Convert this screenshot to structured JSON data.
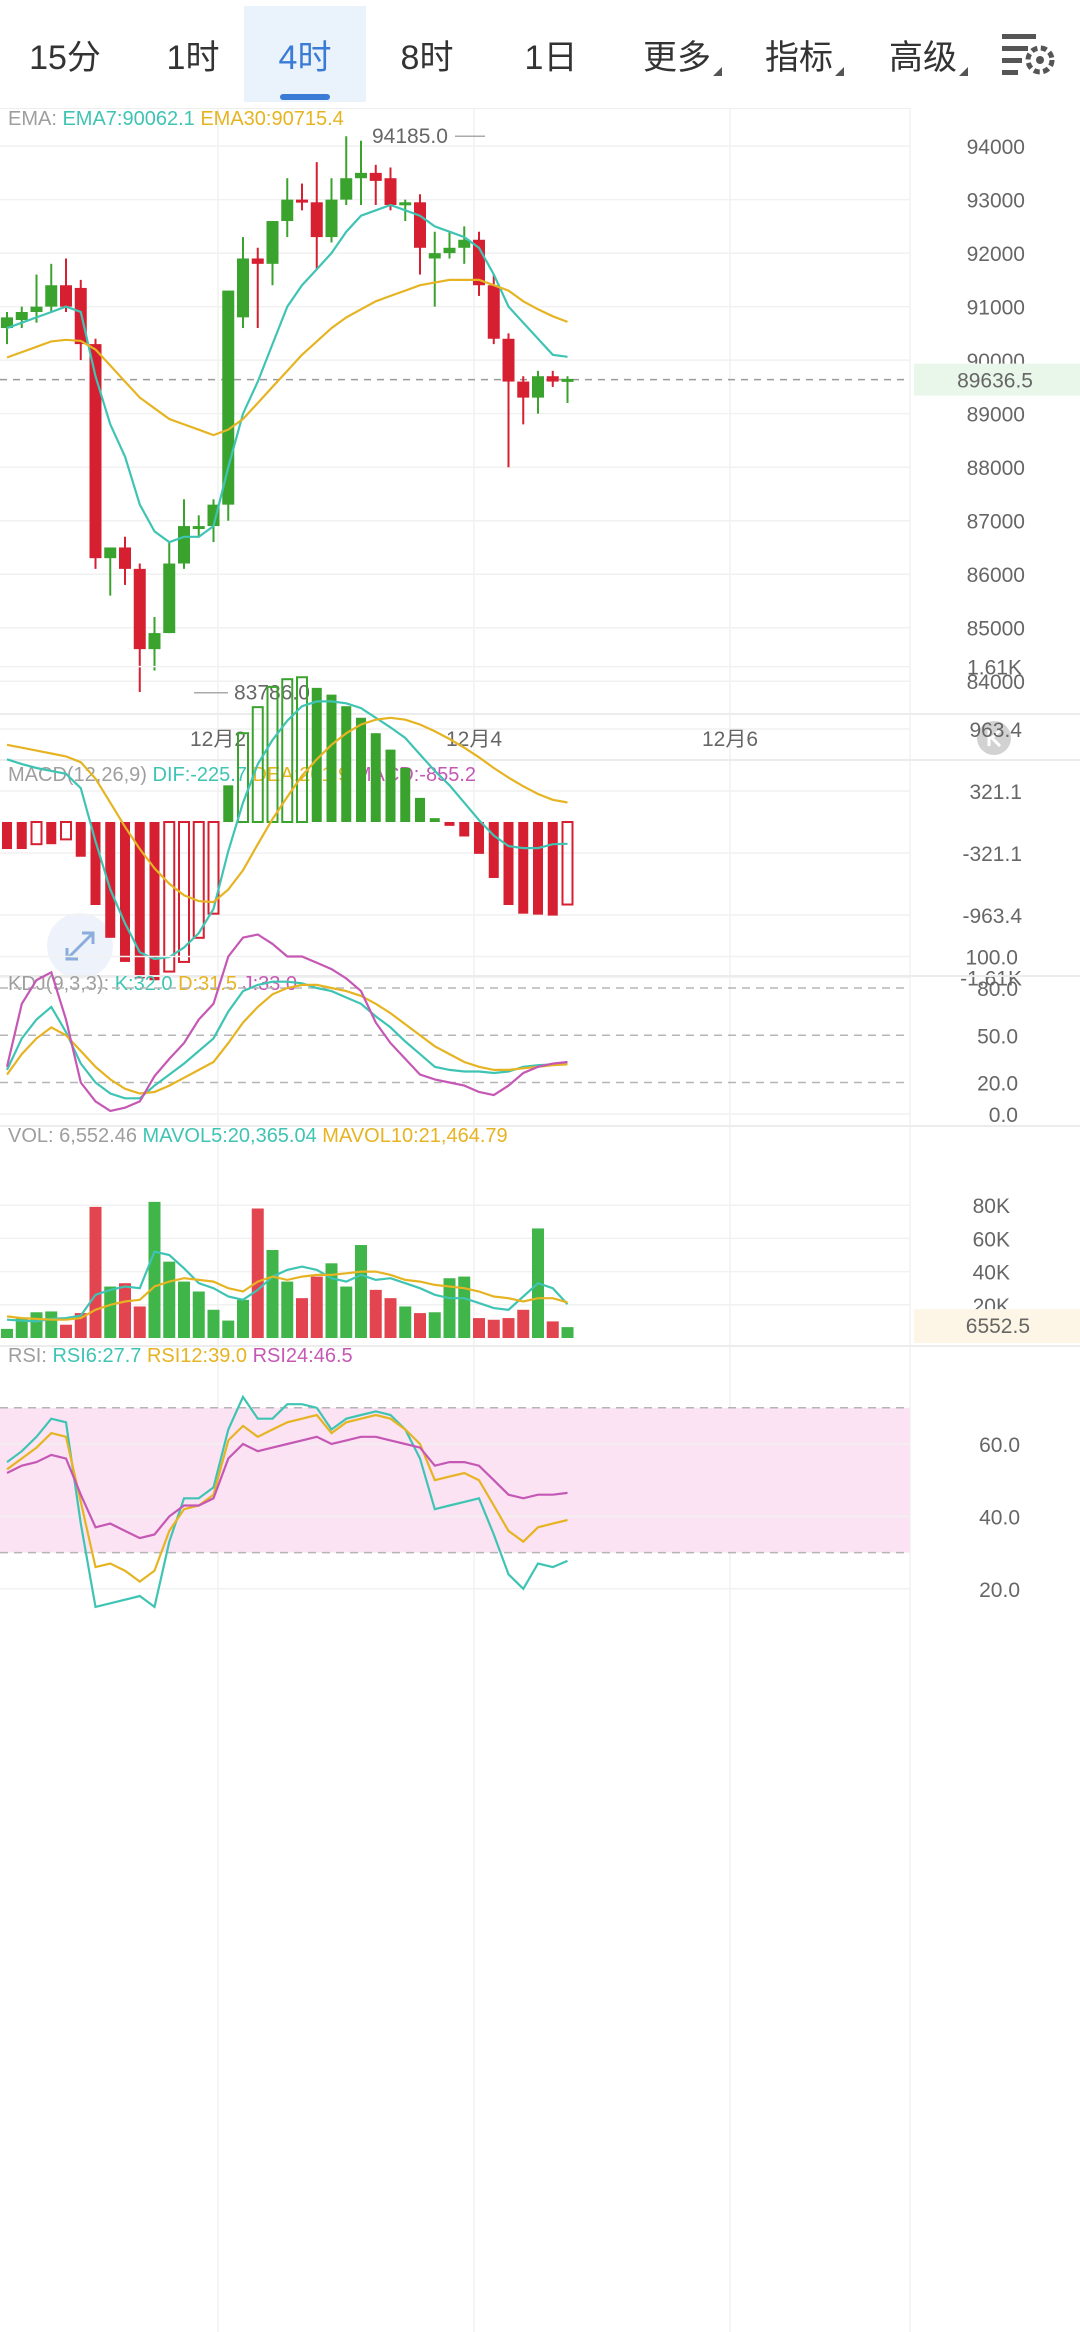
{
  "tabs": [
    {
      "label": "15分",
      "active": false,
      "caret": false
    },
    {
      "label": "1时",
      "active": false,
      "caret": false
    },
    {
      "label": "4时",
      "active": true,
      "caret": false
    },
    {
      "label": "8时",
      "active": false,
      "caret": false
    },
    {
      "label": "1日",
      "active": false,
      "caret": false
    },
    {
      "label": "更多",
      "active": false,
      "caret": true
    },
    {
      "label": "指标",
      "active": false,
      "caret": true
    },
    {
      "label": "高级",
      "active": false,
      "caret": true
    }
  ],
  "settings_icon": "chart-settings-icon",
  "expand_icon": "expand-arrows-icon",
  "scroll_right_icon": "scroll-to-latest-icon",
  "colors": {
    "up": "#3aa32e",
    "down": "#d61f31",
    "cyan": "#3fc4b4",
    "gold": "#e6b422",
    "magenta": "#c558b4",
    "current": "#4caf50"
  },
  "main": {
    "legend": [
      {
        "text": "EMA: ",
        "color": "#9e9e9e"
      },
      {
        "text": "EMA7:90062.1",
        "color": "#3fc4b4"
      },
      {
        "text": "  EMA30:90715.4",
        "color": "#e6b422"
      }
    ],
    "price_ticks": [
      "94000",
      "93000",
      "92000",
      "91000",
      "90000",
      "89000",
      "88000",
      "87000",
      "86000",
      "85000",
      "84000"
    ],
    "current_price": "89636.5",
    "high_label": "94185.0",
    "low_label": "83786.0",
    "date_labels": [
      "12月2",
      "12月4",
      "12月6"
    ]
  },
  "macd": {
    "legend": [
      {
        "text": "MACD(12,26,9) ",
        "color": "#9e9e9e"
      },
      {
        "text": "DIF:-225.7",
        "color": "#3fc4b4"
      },
      {
        "text": "  DEA:201.9",
        "color": "#e6b422"
      },
      {
        "text": "  MACD:-855.2",
        "color": "#c558b4"
      }
    ],
    "ticks": [
      "1.61K",
      "963.4",
      "321.1",
      "-321.1",
      "-963.4",
      "-1.61K"
    ]
  },
  "kdj": {
    "legend": [
      {
        "text": "KDJ(9,3,3): ",
        "color": "#9e9e9e"
      },
      {
        "text": "K:32.0",
        "color": "#3fc4b4"
      },
      {
        "text": "  D:31.5",
        "color": "#e6b422"
      },
      {
        "text": "  J:33.0",
        "color": "#c558b4"
      }
    ],
    "ticks": [
      "100.0",
      "80.0",
      "50.0",
      "20.0",
      "0.0"
    ]
  },
  "vol": {
    "legend": [
      {
        "text": "VOL: 6,552.46  ",
        "color": "#9e9e9e"
      },
      {
        "text": "MAVOL5:20,365.04",
        "color": "#3fc4b4"
      },
      {
        "text": "  MAVOL10:21,464.79",
        "color": "#e6b422"
      }
    ],
    "ticks": [
      "80K",
      "60K",
      "40K",
      "20K"
    ],
    "current": "6552.5"
  },
  "rsi": {
    "legend": [
      {
        "text": "RSI: ",
        "color": "#9e9e9e"
      },
      {
        "text": "RSI6:27.7",
        "color": "#3fc4b4"
      },
      {
        "text": "  RSI12:39.0",
        "color": "#e6b422"
      },
      {
        "text": "  RSI24:46.5",
        "color": "#c558b4"
      }
    ],
    "ticks": [
      "60.0",
      "40.0",
      "20.0"
    ]
  },
  "chart_data": [
    {
      "type": "candlestick",
      "title": "EMA",
      "x_labels": [
        "12月2",
        "12月4",
        "12月6"
      ],
      "ylim": [
        83500,
        94600
      ],
      "candles": [
        {
          "o": 90600,
          "h": 90900,
          "l": 90300,
          "c": 90800
        },
        {
          "o": 90750,
          "h": 91000,
          "l": 90600,
          "c": 90900
        },
        {
          "o": 90900,
          "h": 91600,
          "l": 90700,
          "c": 91000
        },
        {
          "o": 91000,
          "h": 91800,
          "l": 90900,
          "c": 91400
        },
        {
          "o": 91400,
          "h": 91900,
          "l": 90900,
          "c": 91000
        },
        {
          "o": 91350,
          "h": 91500,
          "l": 90000,
          "c": 90300
        },
        {
          "o": 90300,
          "h": 90400,
          "l": 86100,
          "c": 86300
        },
        {
          "o": 86300,
          "h": 86400,
          "l": 85600,
          "c": 86500
        },
        {
          "o": 86500,
          "h": 86700,
          "l": 85800,
          "c": 86100
        },
        {
          "o": 86100,
          "h": 86200,
          "l": 83800,
          "c": 84600
        },
        {
          "o": 84600,
          "h": 85200,
          "l": 84200,
          "c": 84900
        },
        {
          "o": 84900,
          "h": 86600,
          "l": 84900,
          "c": 86200
        },
        {
          "o": 86200,
          "h": 87400,
          "l": 86100,
          "c": 86900
        },
        {
          "o": 86900,
          "h": 87100,
          "l": 86700,
          "c": 86900
        },
        {
          "o": 86900,
          "h": 87400,
          "l": 86600,
          "c": 87300
        },
        {
          "o": 87300,
          "h": 91300,
          "l": 87000,
          "c": 91300
        },
        {
          "o": 90800,
          "h": 92300,
          "l": 90600,
          "c": 91900
        },
        {
          "o": 91900,
          "h": 92100,
          "l": 90600,
          "c": 91800
        },
        {
          "o": 91800,
          "h": 92200,
          "l": 91400,
          "c": 92600
        },
        {
          "o": 92600,
          "h": 93400,
          "l": 92300,
          "c": 93000
        },
        {
          "o": 93000,
          "h": 93300,
          "l": 92800,
          "c": 92950
        },
        {
          "o": 92950,
          "h": 93700,
          "l": 91700,
          "c": 92300
        },
        {
          "o": 92300,
          "h": 93400,
          "l": 92200,
          "c": 93000
        },
        {
          "o": 93000,
          "h": 94185,
          "l": 92900,
          "c": 93400
        },
        {
          "o": 93400,
          "h": 94100,
          "l": 92900,
          "c": 93500
        },
        {
          "o": 93500,
          "h": 93650,
          "l": 92900,
          "c": 93350
        },
        {
          "o": 93400,
          "h": 93600,
          "l": 92800,
          "c": 92900
        },
        {
          "o": 92900,
          "h": 93000,
          "l": 92600,
          "c": 92950
        },
        {
          "o": 92950,
          "h": 93100,
          "l": 91600,
          "c": 92100
        },
        {
          "o": 91900,
          "h": 92400,
          "l": 91000,
          "c": 92000
        },
        {
          "o": 92000,
          "h": 92400,
          "l": 91900,
          "c": 92100
        },
        {
          "o": 92100,
          "h": 92500,
          "l": 91800,
          "c": 92250
        },
        {
          "o": 92250,
          "h": 92400,
          "l": 91200,
          "c": 91400
        },
        {
          "o": 91400,
          "h": 91600,
          "l": 90300,
          "c": 90400
        },
        {
          "o": 90400,
          "h": 90500,
          "l": 88000,
          "c": 89600
        },
        {
          "o": 89600,
          "h": 89700,
          "l": 88800,
          "c": 89300
        },
        {
          "o": 89300,
          "h": 89800,
          "l": 89000,
          "c": 89700
        },
        {
          "o": 89700,
          "h": 89800,
          "l": 89500,
          "c": 89600
        },
        {
          "o": 89600,
          "h": 89700,
          "l": 89200,
          "c": 89650
        }
      ],
      "series": [
        {
          "name": "EMA7",
          "values": [
            90600,
            90700,
            90800,
            90900,
            91000,
            90900,
            89700,
            88800,
            88200,
            87300,
            86800,
            86600,
            86700,
            86700,
            86900,
            88000,
            89000,
            89600,
            90300,
            91000,
            91400,
            91700,
            92000,
            92400,
            92700,
            92800,
            92900,
            92800,
            92700,
            92500,
            92400,
            92300,
            92100,
            91600,
            91000,
            90700,
            90400,
            90100,
            90062
          ]
        },
        {
          "name": "EMA30",
          "values": [
            90050,
            90150,
            90250,
            90350,
            90380,
            90360,
            90200,
            89900,
            89600,
            89300,
            89100,
            88900,
            88800,
            88700,
            88600,
            88700,
            88900,
            89200,
            89500,
            89800,
            90100,
            90350,
            90600,
            90800,
            90950,
            91100,
            91200,
            91300,
            91400,
            91450,
            91500,
            91500,
            91500,
            91400,
            91300,
            91100,
            90950,
            90820,
            90715
          ]
        }
      ]
    },
    {
      "type": "bar",
      "title": "MACD(12,26,9)",
      "ylim": [
        -1900,
        1900
      ],
      "hist": [
        -280,
        -280,
        -230,
        -230,
        -180,
        -360,
        -860,
        -1200,
        -1450,
        -1620,
        -1640,
        -1550,
        -1450,
        -1200,
        -950,
        380,
        920,
        1190,
        1400,
        1480,
        1500,
        1390,
        1320,
        1200,
        1080,
        920,
        750,
        560,
        250,
        40,
        -40,
        -150,
        -330,
        -580,
        -860,
        -950,
        -960,
        -970,
        -855
      ]
    },
    {
      "type": "line",
      "title": "MACD DIF/DEA",
      "series": [
        {
          "name": "DIF",
          "values": [
            650,
            600,
            560,
            530,
            500,
            350,
            -200,
            -700,
            -1050,
            -1350,
            -1420,
            -1400,
            -1300,
            -1150,
            -900,
            -300,
            200,
            600,
            850,
            1050,
            1200,
            1250,
            1250,
            1230,
            1180,
            1080,
            980,
            870,
            700,
            530,
            380,
            200,
            20,
            -140,
            -250,
            -270,
            -270,
            -230,
            -225.7
          ]
        },
        {
          "name": "DEA",
          "values": [
            800,
            770,
            740,
            710,
            680,
            620,
            450,
            200,
            -50,
            -280,
            -480,
            -640,
            -760,
            -820,
            -830,
            -700,
            -500,
            -230,
            30,
            260,
            480,
            650,
            800,
            920,
            1010,
            1060,
            1080,
            1060,
            1010,
            940,
            860,
            770,
            670,
            560,
            460,
            370,
            290,
            230,
            201.9
          ]
        }
      ]
    },
    {
      "type": "line",
      "title": "KDJ(9,3,3)",
      "ylim": [
        0,
        100
      ],
      "series": [
        {
          "name": "K",
          "values": [
            28,
            48,
            60,
            68,
            52,
            32,
            20,
            13,
            10,
            10,
            18,
            25,
            32,
            40,
            48,
            65,
            78,
            82,
            84,
            84,
            83,
            80,
            78,
            74,
            70,
            62,
            55,
            46,
            38,
            30,
            28,
            27,
            27,
            26,
            27,
            30,
            31,
            31.5,
            32
          ]
        },
        {
          "name": "D",
          "values": [
            25,
            38,
            48,
            55,
            50,
            40,
            30,
            22,
            16,
            13,
            14,
            18,
            23,
            28,
            33,
            45,
            58,
            68,
            76,
            80,
            82,
            82,
            80,
            78,
            75,
            70,
            64,
            57,
            50,
            43,
            38,
            33,
            30,
            28,
            28,
            29,
            30,
            31,
            31.5
          ]
        },
        {
          "name": "J",
          "values": [
            30,
            70,
            85,
            90,
            60,
            20,
            8,
            2,
            4,
            8,
            24,
            35,
            45,
            60,
            70,
            100,
            112,
            114,
            108,
            100,
            100,
            96,
            92,
            86,
            78,
            58,
            45,
            35,
            25,
            22,
            20,
            18,
            14,
            12,
            18,
            26,
            30,
            32,
            33
          ]
        }
      ]
    },
    {
      "type": "bar",
      "title": "VOL",
      "ylim": [
        0,
        84000
      ],
      "values": [
        5500,
        12000,
        15500,
        16000,
        8000,
        15000,
        79000,
        31000,
        33000,
        19000,
        82000,
        46000,
        34000,
        28000,
        17000,
        10500,
        23000,
        78000,
        53000,
        34000,
        24000,
        37000,
        45000,
        31000,
        56000,
        29000,
        24000,
        19000,
        15000,
        15500,
        36000,
        37000,
        12000,
        11000,
        12000,
        17000,
        66000,
        10000,
        6552.46
      ],
      "series": [
        {
          "name": "MAVOL5",
          "values": [
            11000,
            10500,
            10000,
            11500,
            12000,
            13500,
            26000,
            29000,
            31000,
            30000,
            52000,
            50000,
            42000,
            33000,
            30000,
            25000,
            23000,
            29000,
            37000,
            41000,
            43000,
            41000,
            36000,
            34000,
            38000,
            35000,
            36000,
            33000,
            30000,
            26000,
            24000,
            24000,
            21000,
            18000,
            17000,
            25000,
            33000,
            30000,
            20365.04
          ]
        },
        {
          "name": "MAVOL10",
          "values": [
            13000,
            12000,
            11500,
            11000,
            11000,
            12000,
            17000,
            20000,
            22000,
            23000,
            31000,
            34000,
            36000,
            35000,
            34000,
            30000,
            28000,
            34000,
            37000,
            35000,
            37000,
            38000,
            38000,
            39000,
            40000,
            40000,
            38000,
            35000,
            34000,
            32000,
            31000,
            30000,
            28000,
            25000,
            24000,
            22000,
            24000,
            24000,
            21464.79
          ]
        }
      ]
    },
    {
      "type": "line",
      "title": "RSI",
      "ylim": [
        12,
        73
      ],
      "bands": [
        30,
        70
      ],
      "series": [
        {
          "name": "RSI6",
          "values": [
            55,
            58,
            62,
            67,
            66,
            38,
            15,
            16,
            17,
            18,
            15,
            33,
            45,
            45,
            48,
            64,
            73,
            67,
            67,
            71,
            71,
            70,
            64,
            67,
            68,
            69,
            68,
            64,
            56,
            42,
            43,
            44,
            45,
            35,
            24,
            20,
            27,
            26,
            27.7
          ]
        },
        {
          "name": "RSI12",
          "values": [
            53,
            56,
            59,
            63,
            62,
            44,
            26,
            27,
            25,
            22,
            25,
            36,
            42,
            43,
            46,
            61,
            65,
            62,
            64,
            66,
            67,
            68,
            63,
            66,
            67,
            68,
            67,
            64,
            60,
            50,
            51,
            52,
            50,
            43,
            36,
            33,
            37,
            38,
            39
          ]
        },
        {
          "name": "RSI24",
          "values": [
            52,
            54,
            55,
            57,
            56,
            46,
            37,
            38,
            36,
            34,
            35,
            40,
            43,
            43,
            45,
            56,
            60,
            58,
            59,
            60,
            61,
            62,
            60,
            61,
            62,
            62,
            61,
            60,
            59,
            54,
            55,
            55,
            54,
            50,
            46,
            45,
            46,
            46,
            46.5
          ]
        }
      ]
    }
  ]
}
